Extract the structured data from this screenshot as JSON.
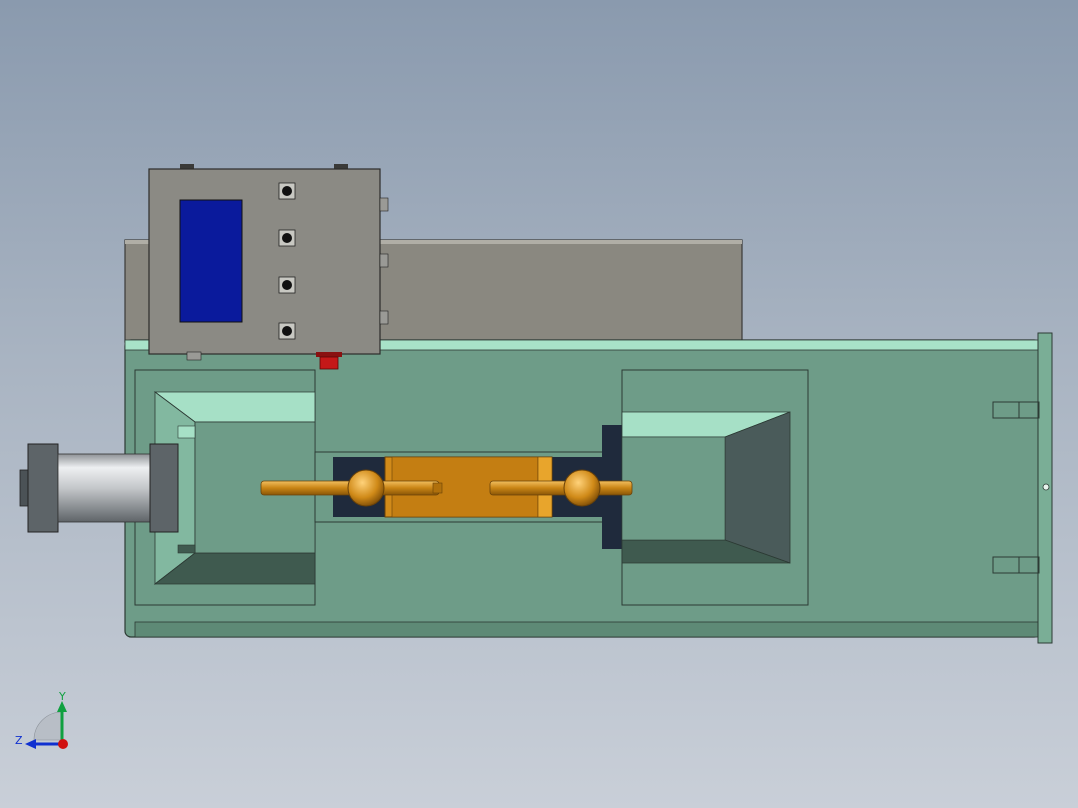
{
  "viewport": {
    "colors": {
      "background_top": "#8a9aae",
      "background_bottom": "#c9cfd8",
      "base_frame": "#6e9c88",
      "base_frame_light": "#9fdcc2",
      "base_frame_dark": "#3f5a4f",
      "control_box": "#8b8a84",
      "control_box_screen": "#0a1a9c",
      "back_panel": "#8a8880",
      "cylinder_steel": "#d8dadc",
      "cylinder_end_cap": "#5d6468",
      "brass_rod": "#d6931f",
      "brass_block": "#d18b1a",
      "clamp_dark": "#1f2a3c",
      "hopper_inner_dark": "#4a5b5a",
      "emergency_button": "#c41818"
    },
    "control_box": {
      "buttons": [
        "button",
        "button",
        "button",
        "button"
      ]
    },
    "triad": {
      "y_label": "Y",
      "z_label": "Z",
      "x_axis_color": "#d01010",
      "y_axis_color": "#10a040",
      "z_axis_color": "#1030d0"
    }
  }
}
